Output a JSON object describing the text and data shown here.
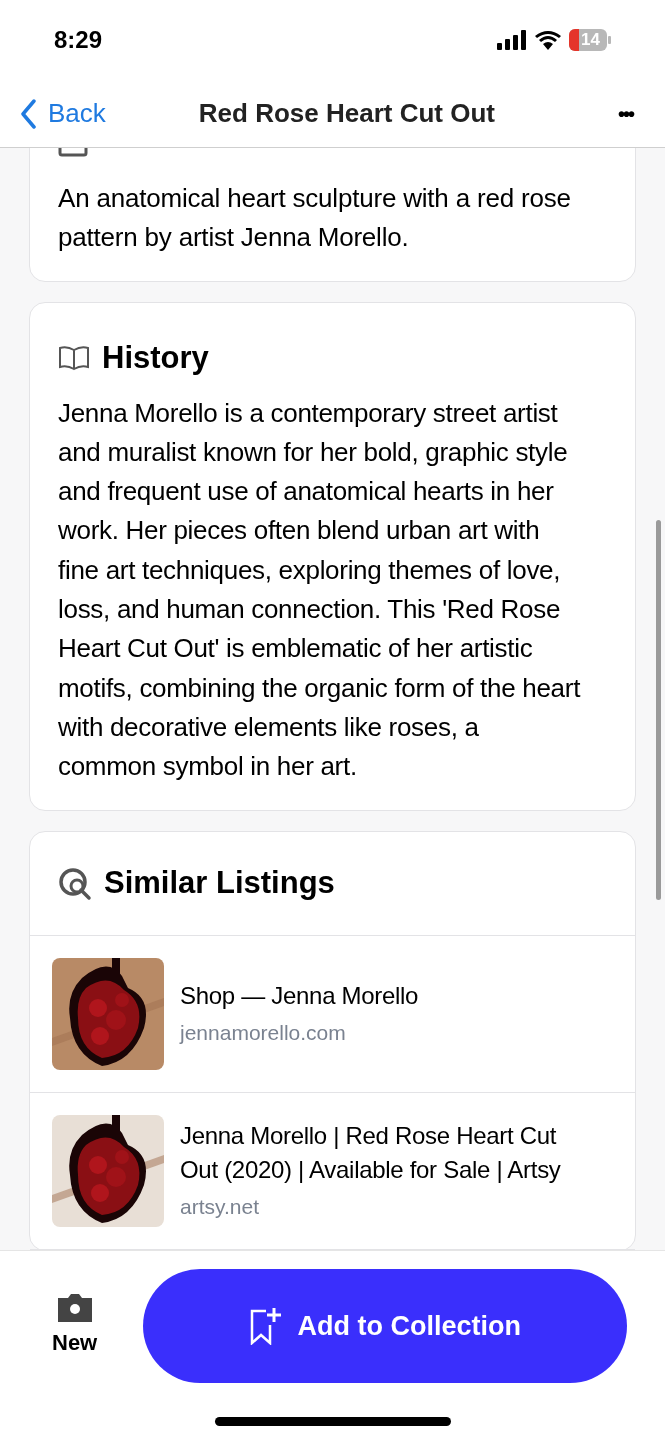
{
  "status_bar": {
    "time": "8:29",
    "battery": "14"
  },
  "nav": {
    "back": "Back",
    "title": "Red Rose Heart Cut Out",
    "more": "•••"
  },
  "description": {
    "text": "An anatomical heart sculpture with a red rose pattern by artist Jenna Morello."
  },
  "history": {
    "title": "History",
    "text": "Jenna Morello is a contemporary street artist and muralist known for her bold, graphic style and frequent use of anatomical hearts in her work. Her pieces often blend urban art with fine art techniques, exploring themes of love, loss, and human connection. This 'Red Rose Heart Cut Out' is emblematic of her artistic motifs, combining the organic form of the heart with decorative elements like roses, a common symbol in her art."
  },
  "similar_listings": {
    "title": "Similar Listings",
    "items": [
      {
        "title": "Shop — Jenna Morello",
        "source": "jennamorello.com"
      },
      {
        "title": "Jenna Morello | Red Rose Heart Cut Out (2020) | Available for Sale | Artsy",
        "source": "artsy.net"
      }
    ]
  },
  "bottom_bar": {
    "new": "New",
    "add": "Add to Collection"
  }
}
